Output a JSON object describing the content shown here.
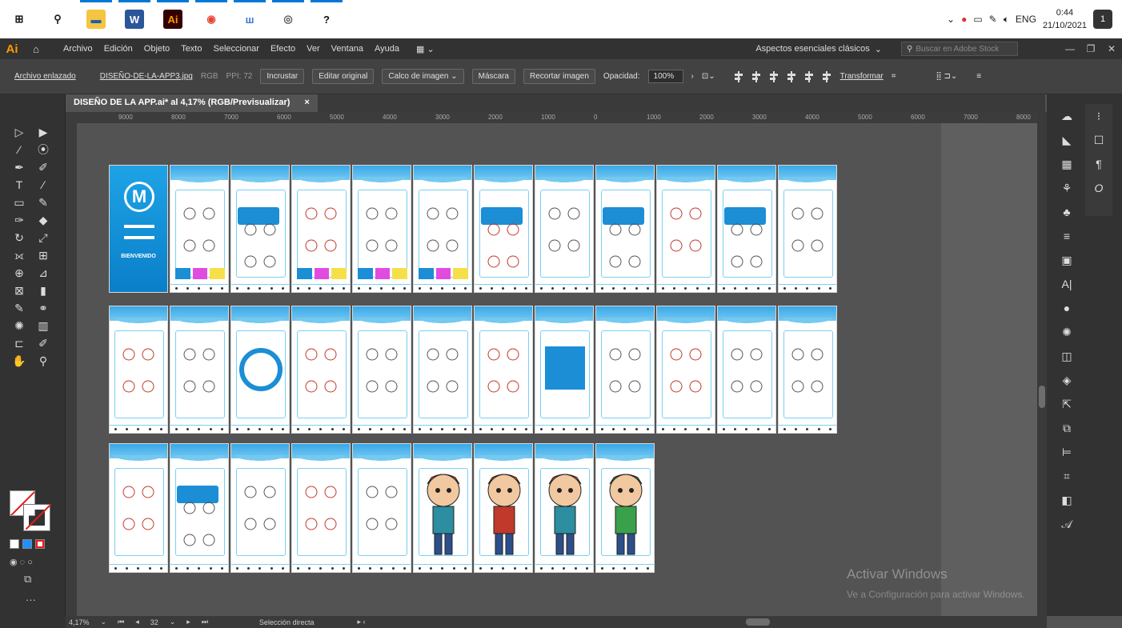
{
  "taskbar": {
    "icons": [
      {
        "name": "windows-start-icon",
        "glyph": "⊞",
        "bg": "#ffffff",
        "fg": "#1a1a1a"
      },
      {
        "name": "search-icon",
        "glyph": "⚲",
        "bg": "#ffffff",
        "fg": "#1a1a1a"
      },
      {
        "name": "file-explorer-icon",
        "glyph": "▬",
        "bg": "#f4c542",
        "fg": "#1d5fa8"
      },
      {
        "name": "word-icon",
        "glyph": "W",
        "bg": "#2b579a",
        "fg": "#ffffff"
      },
      {
        "name": "illustrator-icon",
        "glyph": "Ai",
        "bg": "#330000",
        "fg": "#ff9a00"
      },
      {
        "name": "chrome-icon",
        "glyph": "◉",
        "bg": "#ffffff",
        "fg": "#e84335"
      },
      {
        "name": "app-w-icon",
        "glyph": "ш",
        "bg": "#ffffff",
        "fg": "#3a7ad6"
      },
      {
        "name": "spiral-app-icon",
        "glyph": "◎",
        "bg": "#ffffff",
        "fg": "#555555"
      },
      {
        "name": "question-app-icon",
        "glyph": "?",
        "bg": "#ffffff",
        "fg": "#111111"
      }
    ],
    "tray_language": "ENG",
    "time": "0:44",
    "date": "21/10/2021",
    "notif_count": "1"
  },
  "menubar": {
    "logo": "Ai",
    "items": [
      "Archivo",
      "Edición",
      "Objeto",
      "Texto",
      "Seleccionar",
      "Efecto",
      "Ver",
      "Ventana",
      "Ayuda"
    ],
    "workspace": "Aspectos esenciales clásicos",
    "search_placeholder": "Buscar en Adobe Stock"
  },
  "controlbar": {
    "linked": "Archivo enlazado",
    "filename": "DISEÑO-DE-LA-APP3.jpg",
    "mode": "RGB",
    "ppi": "PPI: 72",
    "embed": "Incrustar",
    "edit_original": "Editar original",
    "trace": "Calco de imagen",
    "mask": "Máscara",
    "crop": "Recortar imagen",
    "opacity_label": "Opacidad:",
    "opacity_value": "100%",
    "transform": "Transformar"
  },
  "document": {
    "tab_title": "DISEÑO DE LA APP.ai* al 4,17% (RGB/Previsualizar)",
    "close": "×"
  },
  "ruler_labels": [
    "9000",
    "8000",
    "7000",
    "6000",
    "5000",
    "4000",
    "3000",
    "2000",
    "1000",
    "0",
    "1000",
    "2000",
    "3000",
    "4000",
    "5000",
    "6000",
    "7000",
    "8000"
  ],
  "artboard_text": {
    "welcome": "BIENVENIDO",
    "logo": "M"
  },
  "statusbar": {
    "zoom": "4,17%",
    "artboard_num": "32",
    "tool": "Selección directa"
  },
  "watermark": {
    "title": "Activar Windows",
    "subtitle": "Ve a Configuración para activar Windows."
  }
}
